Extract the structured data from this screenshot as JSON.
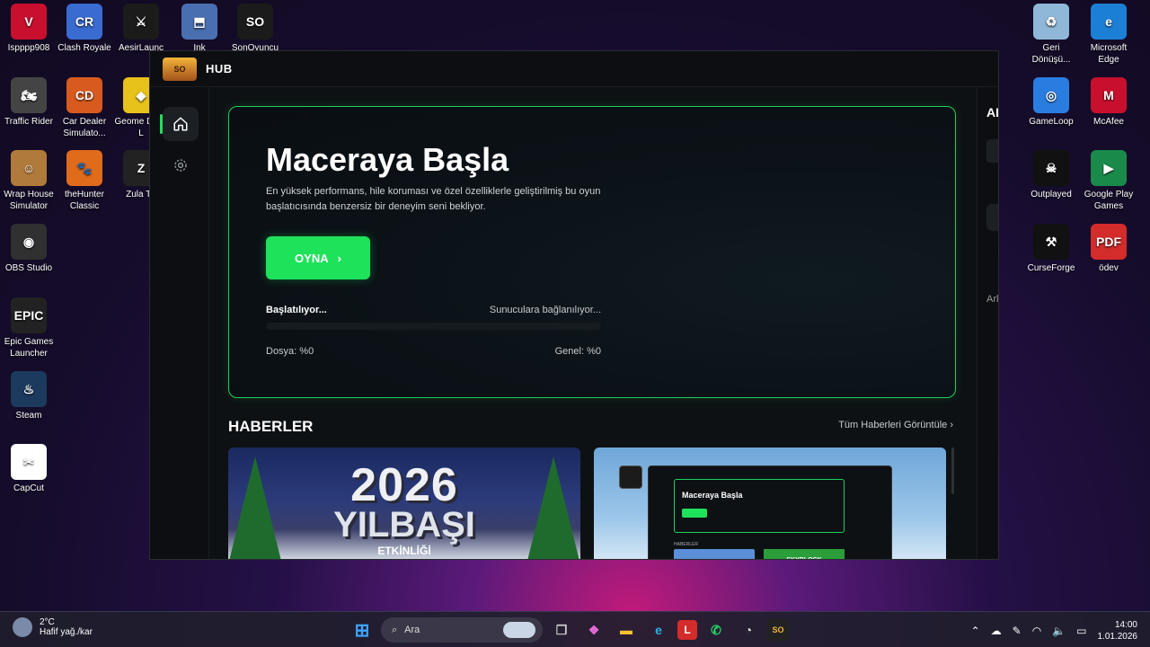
{
  "desktop": {
    "left_icons": [
      {
        "label": "Ispppp908",
        "color": "#c8102e",
        "glyph": "V"
      },
      {
        "label": "Clash Royale",
        "color": "#3a6bd1",
        "glyph": "CR"
      },
      {
        "label": "AesirLaunc",
        "color": "#1b1b1b",
        "glyph": "⚔"
      },
      {
        "label": "Ink",
        "color": "#4a6fb0",
        "glyph": "⬒"
      },
      {
        "label": "SonOyuncu",
        "color": "#1b1b1b",
        "glyph": "SO"
      },
      {
        "label": "Traffic Rider",
        "color": "#444",
        "glyph": "🏍"
      },
      {
        "label": "Car Dealer Simulato...",
        "color": "#d95a1f",
        "glyph": "CD"
      },
      {
        "label": "Geome Dash L",
        "color": "#e6c21a",
        "glyph": "◆"
      },
      {
        "label": "Wrap House Simulator",
        "color": "#b07a3a",
        "glyph": "☺"
      },
      {
        "label": "theHunter Classic",
        "color": "#e06b1a",
        "glyph": "🐾"
      },
      {
        "label": "Zula Tü",
        "color": "#222",
        "glyph": "Z"
      },
      {
        "label": "OBS Studio",
        "color": "#303030",
        "glyph": "◉"
      },
      {
        "label": "Epic Games Launcher",
        "color": "#222",
        "glyph": "EPIC"
      },
      {
        "label": "Steam",
        "color": "#1b3a5e",
        "glyph": "♨"
      },
      {
        "label": "CapCut",
        "color": "#fff",
        "glyph": "✂"
      }
    ],
    "right_icons": [
      {
        "label": "Geri Dönüşü...",
        "color": "#8fb8d8",
        "glyph": "♻"
      },
      {
        "label": "Microsoft Edge",
        "color": "#1c7fd6",
        "glyph": "e"
      },
      {
        "label": "GameLoop",
        "color": "#2a7de0",
        "glyph": "◎"
      },
      {
        "label": "McAfee",
        "color": "#c8102e",
        "glyph": "M"
      },
      {
        "label": "Outplayed",
        "color": "#111",
        "glyph": "☠"
      },
      {
        "label": "Google Play Games",
        "color": "#1a8a4a",
        "glyph": "▶"
      },
      {
        "label": "CurseForge",
        "color": "#111",
        "glyph": "⚒"
      },
      {
        "label": "ödev",
        "color": "#d42b2b",
        "glyph": "PDF"
      }
    ]
  },
  "app": {
    "title": "HUB",
    "logo_text": "SO",
    "hero": {
      "title": "Maceraya Başla",
      "description": "En yüksek performans, hile koruması ve özel özelliklerle geliştirilmiş bu oyun başlatıcısında benzersiz bir deneyim seni bekliyor.",
      "play_label": "OYNA",
      "status_left": "Başlatılıyor...",
      "status_right": "Sunuculara bağlanılıyor...",
      "progress": 0,
      "file_label": "Dosya: %0",
      "general_label": "Genel: %0"
    },
    "news": {
      "heading": "HABERLER",
      "view_all": "Tüm Haberleri Görüntüle",
      "card1": {
        "year": "2026",
        "title": "YILBAŞI",
        "subtitle": "ETKİNLİĞİ"
      },
      "card2": {
        "mini_title": "Maceraya Başla",
        "mini_news": "HABERLER",
        "mini_tag": "SKYBLOCK"
      }
    },
    "right_pane_text": "AF",
    "right_pane_bottom": "Arl"
  },
  "taskbar": {
    "temperature": "2°C",
    "weather_text": "Hafif yağ./kar",
    "search_placeholder": "Ara",
    "time": "14:00",
    "date": "1.01.2026"
  }
}
